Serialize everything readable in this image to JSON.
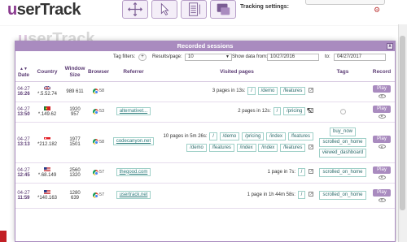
{
  "app": {
    "name_prefix": "u",
    "name_rest": "serTrack",
    "tracking_settings_label": "Tracking settings:"
  },
  "modal": {
    "title": "Recorded sessions",
    "close_label": "x",
    "filters": {
      "tag_filters_label": "Tag filters:",
      "tag_filters_button": "+",
      "results_per_page_label": "Results/page:",
      "results_per_page_value": "10",
      "show_data_from_label": "Show data from:",
      "date_from": "10/27/2016",
      "to_label": "to:",
      "date_to": "04/27/2017"
    },
    "columns": {
      "date": "Date",
      "date_sort": "▲▼",
      "country": "Country",
      "window_size_l1": "Window",
      "window_size_l2": "Size",
      "browser": "Browser",
      "referrer": "Referrer",
      "visited_pages": "Visited pages",
      "tags": "Tags",
      "record": "Record"
    },
    "rows": [
      {
        "day": "04-27",
        "time": "16:26",
        "ip": "*.5.52.74",
        "window": "989 611",
        "browser_version": "58",
        "referrer": "",
        "pages_summary": "3 pages in 13s:",
        "pages": [
          "/",
          "/demo",
          "/features"
        ],
        "tags": [],
        "play_label": "Play"
      },
      {
        "day": "04-27",
        "time": "13:50",
        "ip": "*.149.62",
        "window_w": "1920",
        "window_h": "957",
        "browser_version": "53",
        "referrer": "alternativet...",
        "pages_summary": "2 pages in 12s:",
        "pages": [
          "/",
          "/pricing"
        ],
        "tags": [],
        "play_label": "Play"
      },
      {
        "day": "04-27",
        "time": "13:13",
        "ip": "*212.182",
        "window_w": "1977",
        "window_h": "1501",
        "browser_version": "58",
        "referrer": "codecanyon.net",
        "pages_summary": "10 pages in 5m 26s:",
        "pages_line1": [
          "/",
          "/demo",
          "/pricing",
          "/index",
          "/features"
        ],
        "pages_line2": [
          "/demo",
          "/features",
          "/index",
          "/index",
          "/features"
        ],
        "tags": [
          "buy_now",
          "scrolled_on_home",
          "viewed_dashboard"
        ],
        "play_label": "Play"
      },
      {
        "day": "04-27",
        "time": "12:45",
        "ip": "*.68.149",
        "window_w": "2560",
        "window_h": "1320",
        "browser_version": "57",
        "referrer": "thegood.com",
        "pages_summary": "1 page in 7s:",
        "pages": [
          "/"
        ],
        "tags": [
          "scrolled_on_home"
        ],
        "play_label": "Play"
      },
      {
        "day": "04-27",
        "time": "11:59",
        "ip": "*140.163",
        "window_w": "1280",
        "window_h": "639",
        "browser_version": "57",
        "referrer": "usertrack.net",
        "pages_summary": "1 page in 1h 44m 58s:",
        "pages": [
          "/"
        ],
        "tags": [
          "scrolled_on_home"
        ],
        "play_label": "Play"
      }
    ]
  },
  "colors": {
    "accent": "#a98bbf",
    "accent_dark": "#5a3a73",
    "chip_border": "#9fd0c8"
  }
}
